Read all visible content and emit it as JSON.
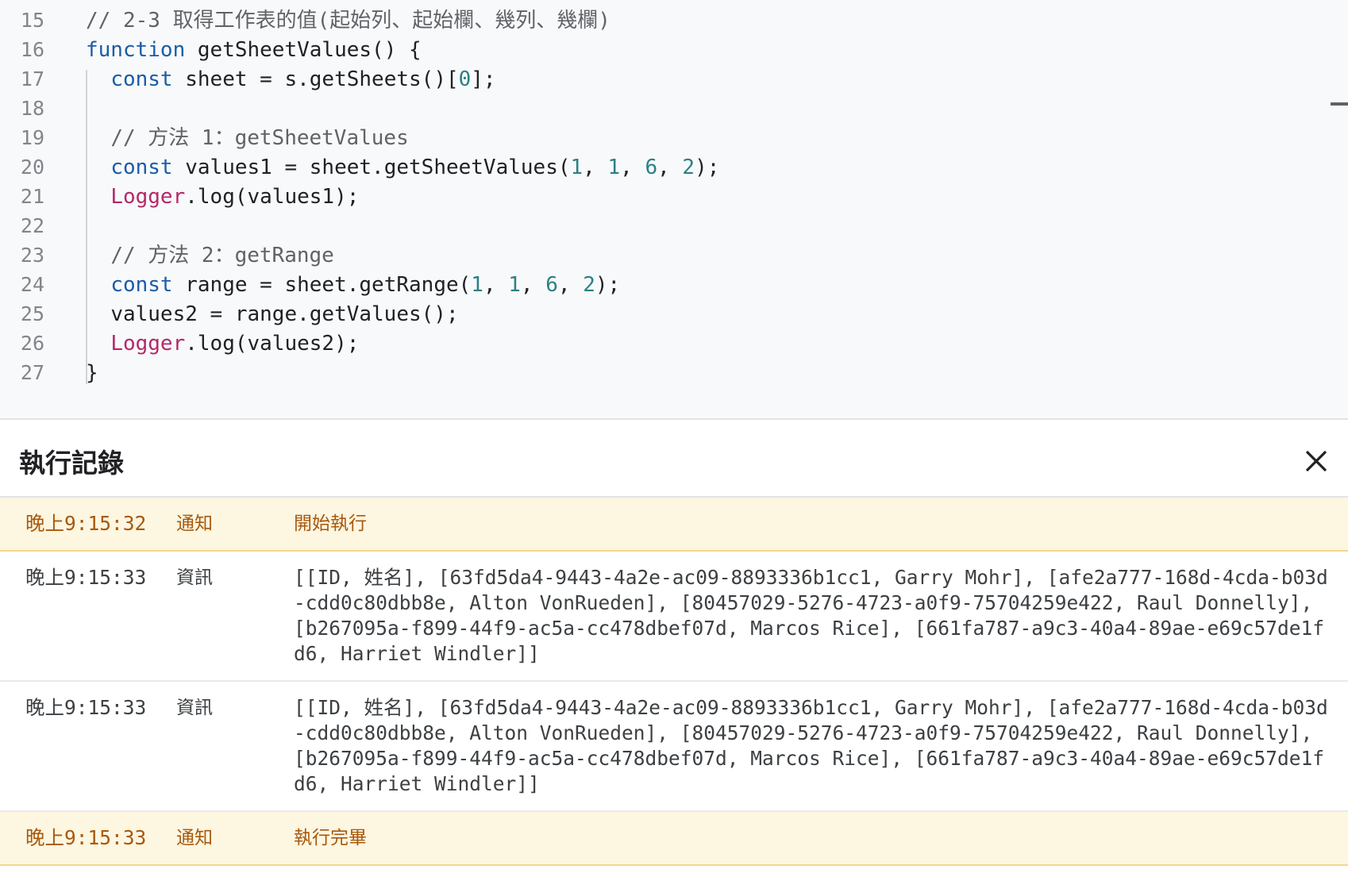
{
  "editor": {
    "lines": [
      {
        "num": "15",
        "indent": "",
        "tokens": [
          {
            "t": "// 2-3 取得工作表的值(起始列、起始欄、幾列、幾欄)",
            "c": "cm"
          }
        ]
      },
      {
        "num": "16",
        "indent": "",
        "tokens": [
          {
            "t": "function",
            "c": "kw"
          },
          {
            "t": " getSheetValues() {",
            "c": "pl"
          }
        ]
      },
      {
        "num": "17",
        "indent": "  ",
        "tokens": [
          {
            "t": "const",
            "c": "kw"
          },
          {
            "t": " sheet = s.getSheets()[",
            "c": "pl"
          },
          {
            "t": "0",
            "c": "num"
          },
          {
            "t": "];",
            "c": "pl"
          }
        ]
      },
      {
        "num": "18",
        "indent": "",
        "tokens": []
      },
      {
        "num": "19",
        "indent": "  ",
        "tokens": [
          {
            "t": "// 方法 1：getSheetValues",
            "c": "cm"
          }
        ]
      },
      {
        "num": "20",
        "indent": "  ",
        "tokens": [
          {
            "t": "const",
            "c": "kw"
          },
          {
            "t": " values1 = sheet.getSheetValues(",
            "c": "pl"
          },
          {
            "t": "1",
            "c": "num"
          },
          {
            "t": ", ",
            "c": "pl"
          },
          {
            "t": "1",
            "c": "num"
          },
          {
            "t": ", ",
            "c": "pl"
          },
          {
            "t": "6",
            "c": "num"
          },
          {
            "t": ", ",
            "c": "pl"
          },
          {
            "t": "2",
            "c": "num"
          },
          {
            "t": ");",
            "c": "pl"
          }
        ]
      },
      {
        "num": "21",
        "indent": "  ",
        "tokens": [
          {
            "t": "Logger",
            "c": "cls"
          },
          {
            "t": ".log(values1);",
            "c": "pl"
          }
        ]
      },
      {
        "num": "22",
        "indent": "",
        "tokens": []
      },
      {
        "num": "23",
        "indent": "  ",
        "tokens": [
          {
            "t": "// 方法 2：getRange",
            "c": "cm"
          }
        ]
      },
      {
        "num": "24",
        "indent": "  ",
        "tokens": [
          {
            "t": "const",
            "c": "kw"
          },
          {
            "t": " range = sheet.getRange(",
            "c": "pl"
          },
          {
            "t": "1",
            "c": "num"
          },
          {
            "t": ", ",
            "c": "pl"
          },
          {
            "t": "1",
            "c": "num"
          },
          {
            "t": ", ",
            "c": "pl"
          },
          {
            "t": "6",
            "c": "num"
          },
          {
            "t": ", ",
            "c": "pl"
          },
          {
            "t": "2",
            "c": "num"
          },
          {
            "t": ");",
            "c": "pl"
          }
        ]
      },
      {
        "num": "25",
        "indent": "  ",
        "tokens": [
          {
            "t": "values2 = range.getValues();",
            "c": "pl"
          }
        ]
      },
      {
        "num": "26",
        "indent": "  ",
        "tokens": [
          {
            "t": "Logger",
            "c": "cls"
          },
          {
            "t": ".log(values2);",
            "c": "pl"
          }
        ]
      },
      {
        "num": "27",
        "indent": "",
        "tokens": [
          {
            "t": "}",
            "c": "pl"
          }
        ]
      }
    ]
  },
  "log_panel": {
    "title": "執行記錄",
    "close_icon": "close-icon",
    "entries": [
      {
        "time": "晚上9:15:32",
        "level": "通知",
        "type": "notice",
        "message": "開始執行"
      },
      {
        "time": "晚上9:15:33",
        "level": "資訊",
        "type": "info",
        "message": "[[ID, 姓名], [63fd5da4-9443-4a2e-ac09-8893336b1cc1, Garry Mohr], [afe2a777-168d-4cda-b03d-cdd0c80dbb8e, Alton VonRueden], [80457029-5276-4723-a0f9-75704259e422, Raul Donnelly], [b267095a-f899-44f9-ac5a-cc478dbef07d, Marcos Rice], [661fa787-a9c3-40a4-89ae-e69c57de1fd6, Harriet Windler]]"
      },
      {
        "time": "晚上9:15:33",
        "level": "資訊",
        "type": "info",
        "message": "[[ID, 姓名], [63fd5da4-9443-4a2e-ac09-8893336b1cc1, Garry Mohr], [afe2a777-168d-4cda-b03d-cdd0c80dbb8e, Alton VonRueden], [80457029-5276-4723-a0f9-75704259e422, Raul Donnelly], [b267095a-f899-44f9-ac5a-cc478dbef07d, Marcos Rice], [661fa787-a9c3-40a4-89ae-e69c57de1fd6, Harriet Windler]]"
      },
      {
        "time": "晚上9:15:33",
        "level": "通知",
        "type": "notice",
        "message": "執行完畢"
      }
    ]
  },
  "colors": {
    "keyword": "#1a5ca8",
    "number": "#2b8083",
    "comment": "#5f6368",
    "class": "#b52869",
    "notice_bg": "#fdf6e1",
    "notice_text": "#a8590c"
  }
}
